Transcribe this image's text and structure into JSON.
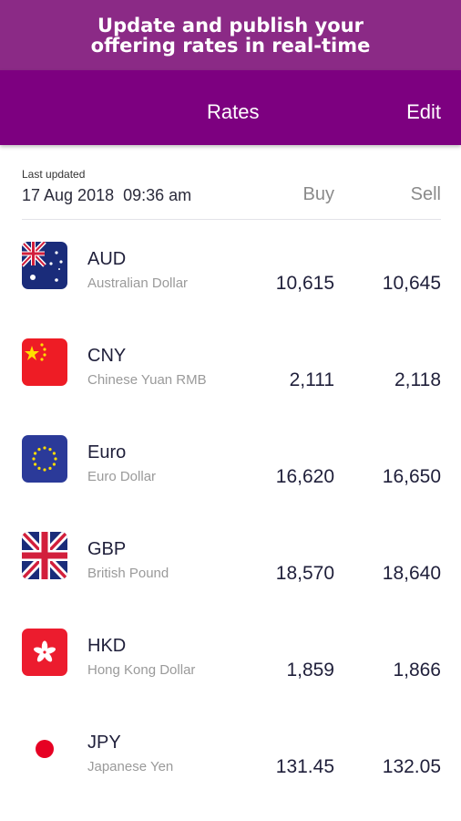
{
  "promo": {
    "line1": "Update and publish your",
    "line2": "offering rates in real-time"
  },
  "appbar": {
    "tab_label": "Rates",
    "edit_label": "Edit"
  },
  "header": {
    "last_updated_label": "Last updated",
    "last_updated_value": "17 Aug 2018  09:36 am",
    "buy_label": "Buy",
    "sell_label": "Sell"
  },
  "rates": [
    {
      "code": "AUD",
      "name": "Australian Dollar",
      "buy": "10,615",
      "sell": "10,645",
      "flag_icon": "australia-flag-icon"
    },
    {
      "code": "CNY",
      "name": "Chinese Yuan RMB",
      "buy": "2,111",
      "sell": "2,118",
      "flag_icon": "china-flag-icon"
    },
    {
      "code": "Euro",
      "name": "Euro Dollar",
      "buy": "16,620",
      "sell": "16,650",
      "flag_icon": "eu-flag-icon"
    },
    {
      "code": "GBP",
      "name": "British Pound",
      "buy": "18,570",
      "sell": "18,640",
      "flag_icon": "uk-flag-icon"
    },
    {
      "code": "HKD",
      "name": "Hong Kong Dollar",
      "buy": "1,859",
      "sell": "1,866",
      "flag_icon": "hong-kong-flag-icon"
    },
    {
      "code": "JPY",
      "name": "Japanese Yen",
      "buy": "131.45",
      "sell": "132.05",
      "flag_icon": "japan-flag-icon"
    }
  ],
  "colors": {
    "promo_bg": "#8b2a86",
    "appbar_bg": "#7d0080"
  }
}
